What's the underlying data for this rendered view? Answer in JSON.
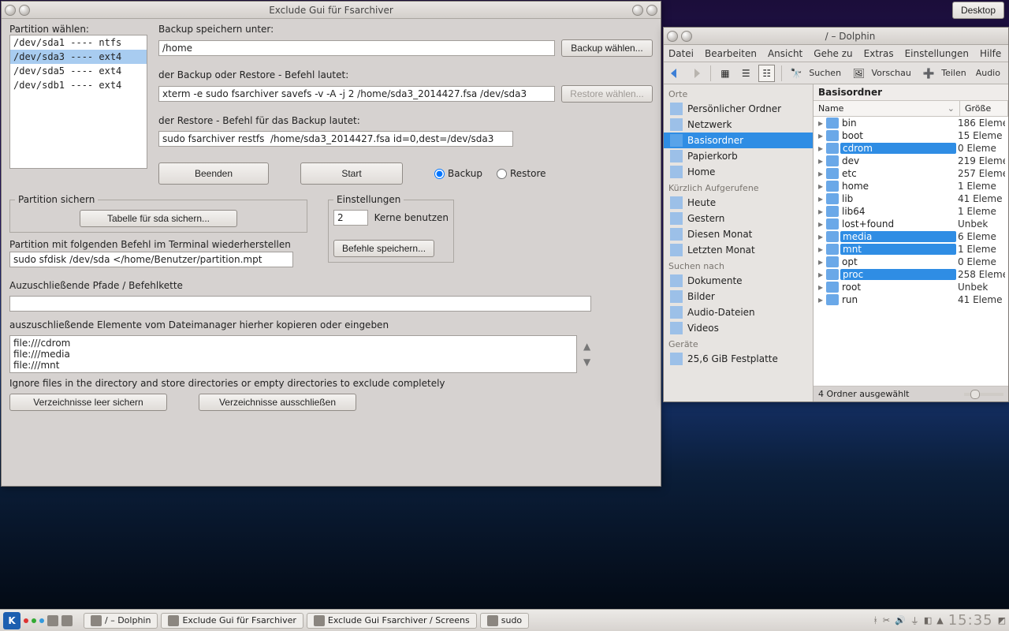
{
  "desktop_button": "Desktop",
  "fsarchiver": {
    "title": "Exclude Gui für Fsarchiver",
    "partition_label": "Partition wählen:",
    "partitions": [
      "/dev/sda1  ----  ntfs",
      "/dev/sda3  ----  ext4",
      "/dev/sda5  ----  ext4",
      "/dev/sdb1  ----  ext4"
    ],
    "selected_partition_index": 1,
    "backup_path_label": "Backup speichern unter:",
    "backup_path": "/home",
    "backup_choose_btn": "Backup wählen...",
    "command_label": "der Backup oder Restore - Befehl lautet:",
    "command": "xterm -e sudo fsarchiver savefs -v -A -j 2 /home/sda3_2014427.fsa /dev/sda3",
    "restore_choose_btn": "Restore wählen...",
    "restore_label": "der Restore - Befehl für das Backup lautet:",
    "restore_cmd": "sudo fsarchiver restfs  /home/sda3_2014427.fsa id=0,dest=/dev/sda3",
    "quit_btn": "Beenden",
    "start_btn": "Start",
    "radio_backup": "Backup",
    "radio_restore": "Restore",
    "partition_secure_legend": "Partition sichern",
    "table_btn": "Tabelle für sda sichern...",
    "restore_terminal_label": "Partition mit folgenden Befehl im Terminal wiederherstellen",
    "restore_terminal_cmd": "sudo sfdisk /dev/sda </home/Benutzer/partition.mpt",
    "settings_legend": "Einstellungen",
    "cores_value": "2",
    "cores_label": "Kerne benutzen",
    "save_cmds_btn": "Befehle speichern...",
    "exclude_label": "Auzuschließende Pfade / Befehlkette",
    "exclude_value": "",
    "exclude_hint": "auszuschließende Elemente vom Dateimanager hierher kopieren oder eingeben",
    "exclude_list": "file:///cdrom\nfile:///media\nfile:///mnt",
    "ignore_label": "Ignore files in the directory and store directories or empty directories to exclude completely",
    "empty_dirs_btn": "Verzeichnisse leer sichern",
    "exclude_dirs_btn": "Verzeichnisse ausschließen"
  },
  "dolphin": {
    "title": "/ – Dolphin",
    "menu": [
      "Datei",
      "Bearbeiten",
      "Ansicht",
      "Gehe zu",
      "Extras",
      "Einstellungen",
      "Hilfe"
    ],
    "toolbar": {
      "search": "Suchen",
      "preview": "Vorschau",
      "share": "Teilen",
      "audio": "Audio"
    },
    "places_header_1": "Orte",
    "places_1": [
      "Persönlicher Ordner",
      "Netzwerk",
      "Basisordner",
      "Papierkorb",
      "Home"
    ],
    "places_1_selected": 2,
    "places_header_2": "Kürzlich Aufgerufene",
    "places_2": [
      "Heute",
      "Gestern",
      "Diesen Monat",
      "Letzten Monat"
    ],
    "places_header_3": "Suchen nach",
    "places_3": [
      "Dokumente",
      "Bilder",
      "Audio-Dateien",
      "Videos"
    ],
    "places_header_4": "Geräte",
    "places_4": [
      "25,6 GiB Festplatte"
    ],
    "location": "Basisordner",
    "col_name": "Name",
    "col_size": "Größe",
    "rows": [
      {
        "name": "bin",
        "size": "186 Eleme",
        "sel": false
      },
      {
        "name": "boot",
        "size": "15 Eleme",
        "sel": false
      },
      {
        "name": "cdrom",
        "size": "0 Eleme",
        "sel": true
      },
      {
        "name": "dev",
        "size": "219 Eleme",
        "sel": false
      },
      {
        "name": "etc",
        "size": "257 Eleme",
        "sel": false
      },
      {
        "name": "home",
        "size": "1 Eleme",
        "sel": false
      },
      {
        "name": "lib",
        "size": "41 Eleme",
        "sel": false
      },
      {
        "name": "lib64",
        "size": "1 Eleme",
        "sel": false
      },
      {
        "name": "lost+found",
        "size": "Unbek",
        "sel": false
      },
      {
        "name": "media",
        "size": "6 Eleme",
        "sel": true
      },
      {
        "name": "mnt",
        "size": "1 Eleme",
        "sel": true
      },
      {
        "name": "opt",
        "size": "0 Eleme",
        "sel": false
      },
      {
        "name": "proc",
        "size": "258 Eleme",
        "sel": true
      },
      {
        "name": "root",
        "size": "Unbek",
        "sel": false
      },
      {
        "name": "run",
        "size": "41 Eleme",
        "sel": false
      }
    ],
    "status": "4 Ordner ausgewählt"
  },
  "taskbar": {
    "tasks": [
      "/ – Dolphin",
      "Exclude Gui für Fsarchiver",
      "Exclude Gui Fsarchiver / Screens",
      "sudo"
    ],
    "clock": "15:35"
  }
}
